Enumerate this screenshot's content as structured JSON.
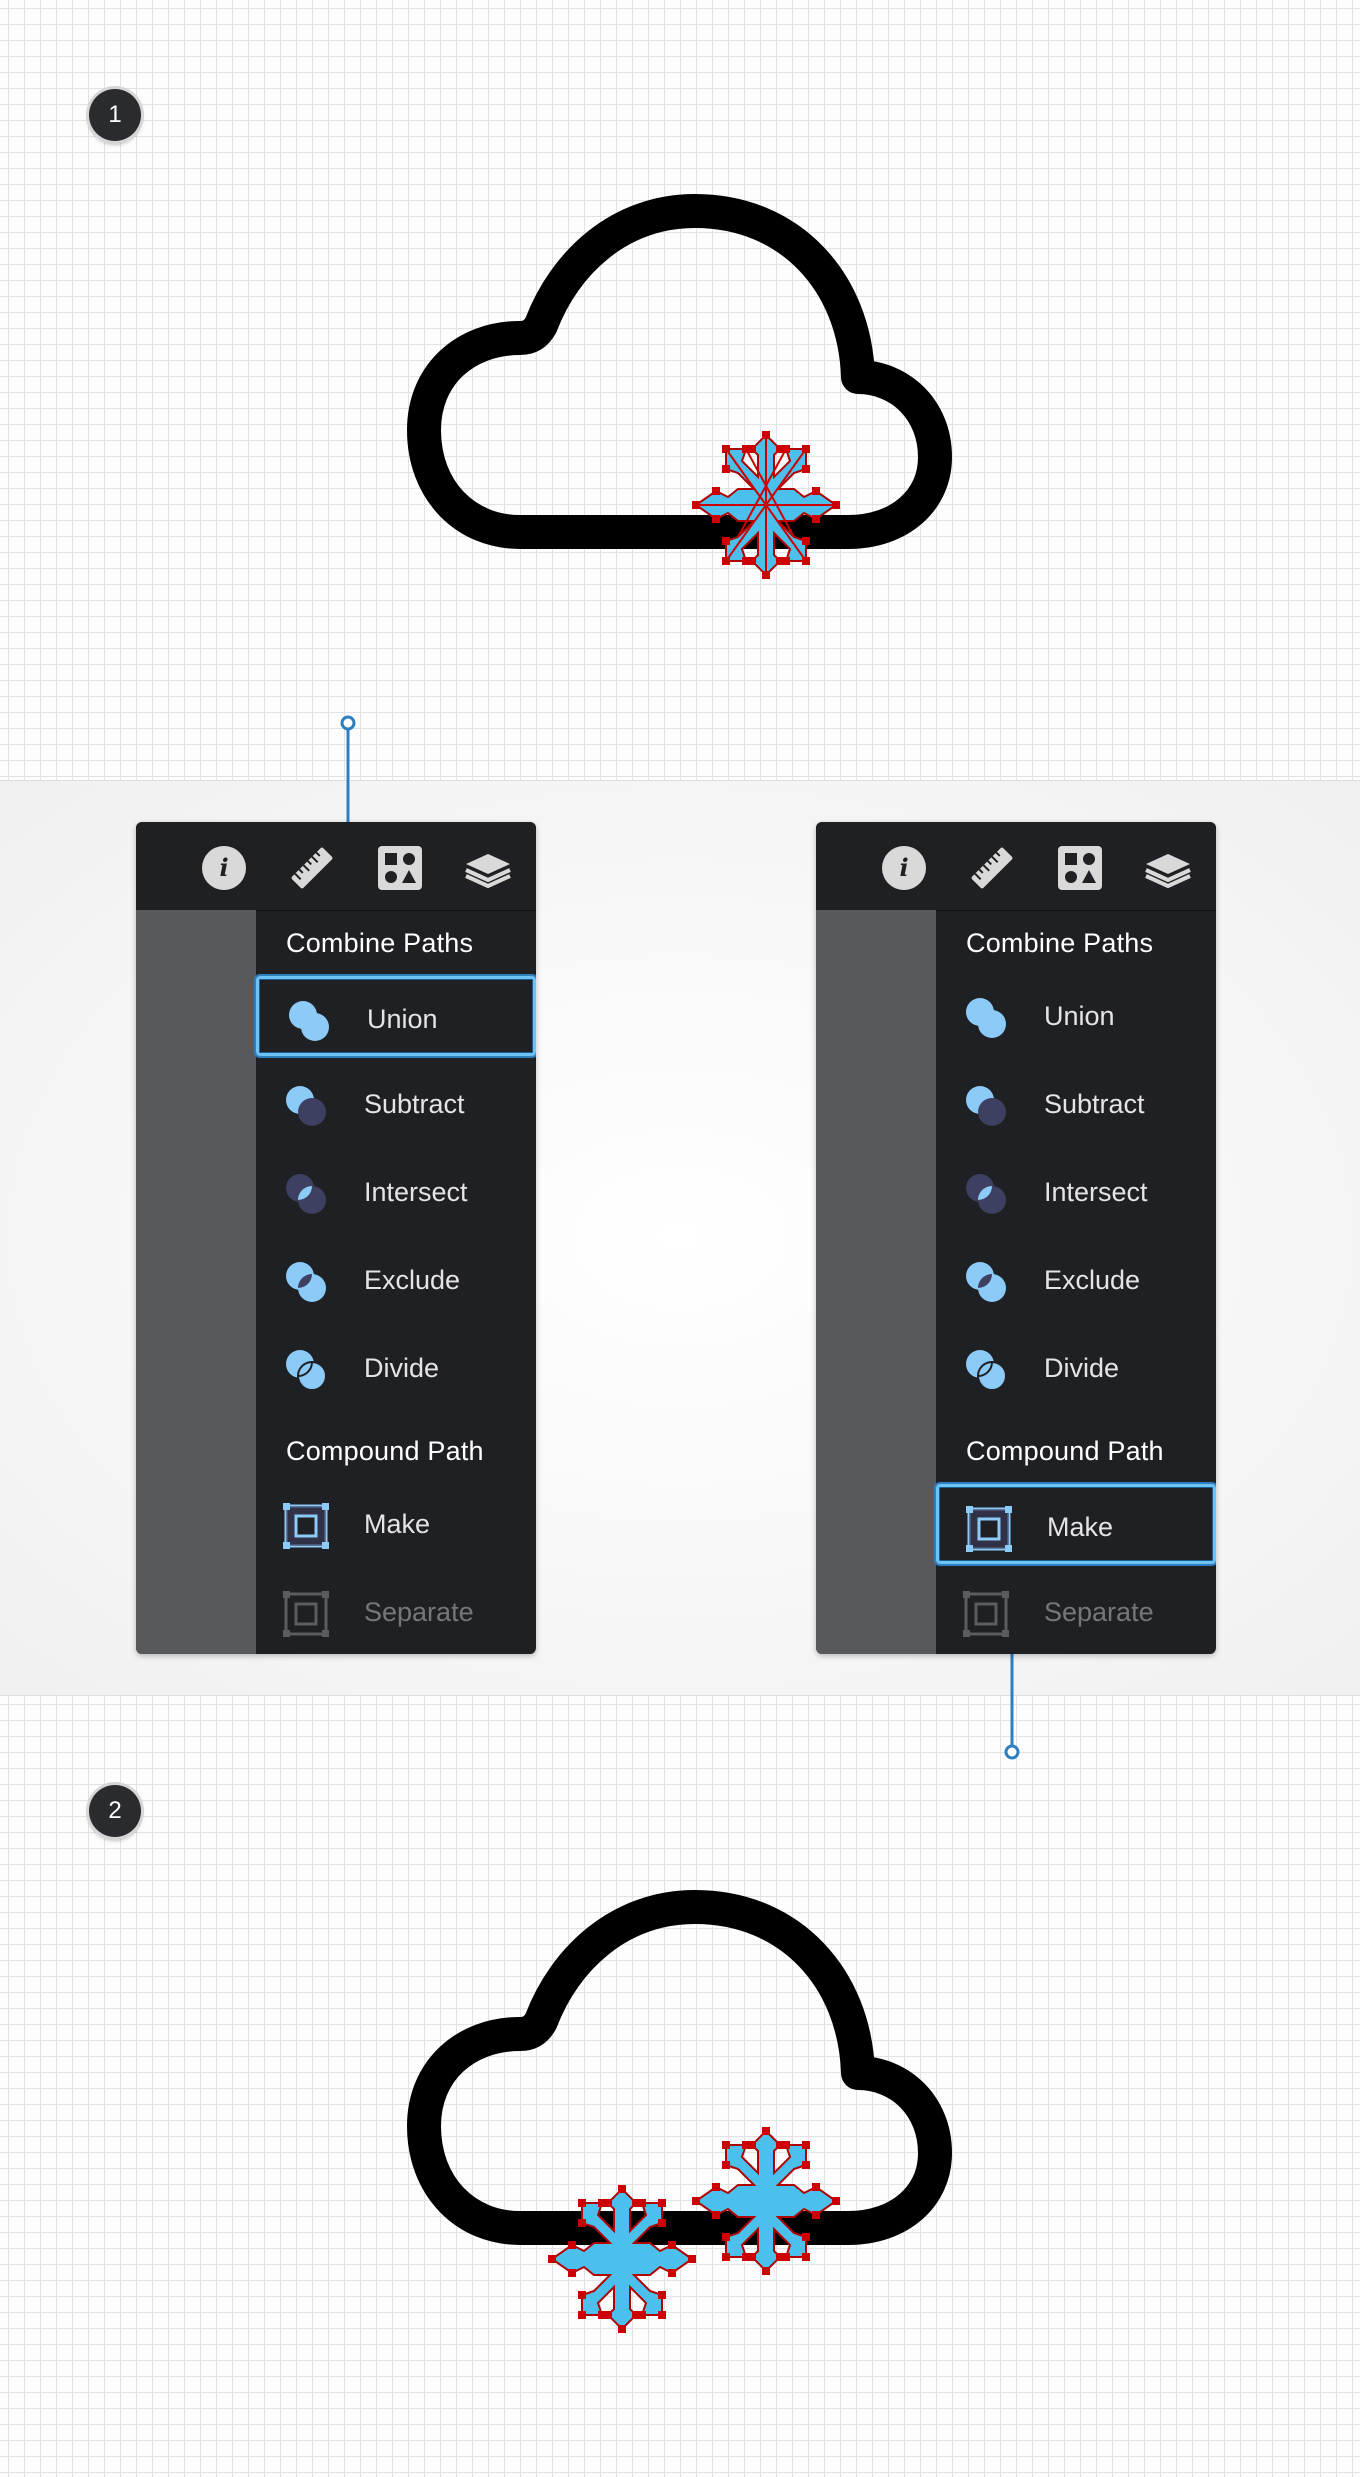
{
  "steps": {
    "step1": "1",
    "step2": "2"
  },
  "panels": {
    "left": {
      "combine_title": "Combine Paths",
      "compound_title": "Compound Path",
      "items": [
        "Union",
        "Subtract",
        "Intersect",
        "Exclude",
        "Divide",
        "Make",
        "Separate"
      ],
      "highlighted": "Union"
    },
    "right": {
      "combine_title": "Combine Paths",
      "compound_title": "Compound Path",
      "items": [
        "Union",
        "Subtract",
        "Intersect",
        "Exclude",
        "Divide",
        "Make",
        "Separate"
      ],
      "highlighted": "Make"
    }
  },
  "toolbar_icons": [
    "info-icon",
    "ruler-icon",
    "shapes-icon",
    "layers-icon"
  ],
  "colors": {
    "snowflake_fill": "#4bc0ec",
    "anchor_points": "#cc0000",
    "highlight_border": "#6ec1f5",
    "cloud_stroke": "#000000",
    "panel_bg": "#1f2023"
  }
}
